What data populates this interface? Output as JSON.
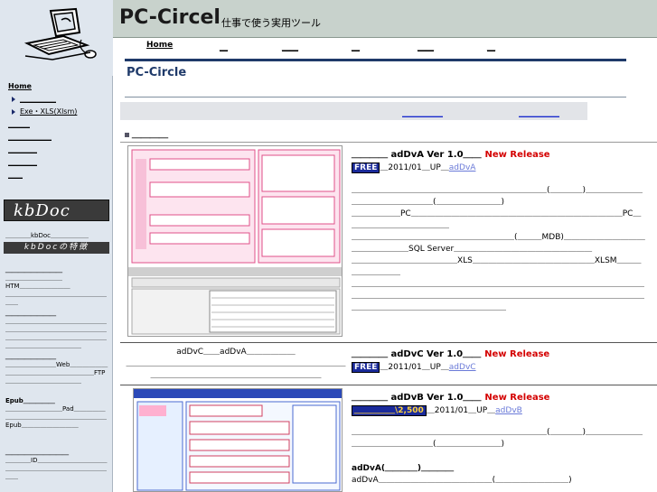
{
  "header": {
    "title": "PC-Circel",
    "subtitle": "仕事で使う実用ツール"
  },
  "topnav": {
    "items": [
      "Home",
      "＿",
      "＿＿",
      "＿",
      "＿＿",
      "＿"
    ]
  },
  "page": {
    "heading": "PC-Circle"
  },
  "subnav": {
    "links": [
      "＿＿＿＿＿",
      "＿＿＿＿＿"
    ]
  },
  "section": {
    "title": "＿＿＿＿"
  },
  "sidebar": {
    "nav": [
      {
        "label": "Home",
        "bold": true,
        "sub": false
      },
      {
        "label": "＿＿＿＿＿",
        "bold": false,
        "sub": true
      },
      {
        "label": "Exe・XLS(Xlsm)",
        "bold": false,
        "sub": true
      },
      {
        "label": "＿＿＿",
        "bold": false,
        "sub": false
      },
      {
        "label": "＿＿＿＿＿＿",
        "bold": false,
        "sub": false
      },
      {
        "label": "＿＿＿＿",
        "bold": false,
        "sub": false
      },
      {
        "label": "＿＿＿＿",
        "bold": false,
        "sub": false
      },
      {
        "label": "＿＿",
        "bold": false,
        "sub": false
      }
    ],
    "kbdoc_logo": "kbDoc",
    "kbdoc_intro": "＿＿＿＿kbDoc＿＿＿＿＿＿",
    "kbdoc_feature": "kbDocの特徴",
    "blocks": [
      {
        "heading": "＿＿＿＿＿＿＿＿＿",
        "lines": [
          "＿＿＿＿＿＿＿＿＿",
          "HTM＿＿＿＿＿＿＿＿",
          "＿＿＿＿＿＿＿＿＿＿＿＿＿＿＿＿＿＿"
        ]
      },
      {
        "heading": "＿＿＿＿＿＿＿＿",
        "lines": [
          "＿＿＿＿＿＿＿＿＿＿＿＿＿＿＿＿＿＿＿＿＿＿＿＿＿＿＿＿＿＿＿＿＿＿＿＿＿＿＿＿＿＿＿＿＿＿＿＿＿＿＿＿＿＿＿＿＿＿＿＿"
        ]
      },
      {
        "heading": "＿＿＿＿＿＿＿＿",
        "lines": [
          "＿＿＿＿＿＿＿＿Web＿＿＿＿＿＿＿＿＿＿＿＿＿＿＿＿＿＿＿＿FTP＿＿＿＿＿＿＿＿＿＿＿＿"
        ]
      },
      {
        "heading": "Epub＿＿＿＿＿",
        "lines": [
          "＿＿＿＿＿＿＿＿＿Pad＿＿＿＿＿＿＿＿＿＿＿＿＿＿＿＿＿＿＿＿＿Epub＿＿＿＿＿＿＿＿＿"
        ]
      },
      {
        "heading": "＿＿＿＿＿＿＿＿＿＿",
        "lines": [
          "＿＿＿＿ID＿＿＿＿＿＿＿＿＿＿＿＿＿＿＿＿＿＿＿＿＿＿＿＿＿＿＿＿＿"
        ]
      }
    ]
  },
  "products": [
    {
      "title": "＿＿＿＿ adDvA Ver 1.0＿＿",
      "badge": "New Release",
      "price": "FREE",
      "date": "＿2011/01＿UP＿",
      "link": "adDvA",
      "desc": [
        "＿＿＿＿＿＿＿＿＿＿＿＿＿＿＿＿＿＿＿＿＿＿＿＿(＿＿＿＿)＿＿＿＿＿＿＿＿＿＿＿＿＿＿＿＿＿(＿＿＿＿＿＿＿＿)",
        "＿＿＿＿＿＿PC＿＿＿＿＿＿＿＿＿＿＿＿＿＿＿＿＿＿＿＿＿＿＿＿＿＿PC＿＿＿＿＿＿＿＿＿＿＿＿＿",
        "＿＿＿＿＿＿＿＿＿＿＿＿＿＿＿＿＿＿＿＿(＿＿＿MDB)＿＿＿＿＿＿＿＿＿＿＿＿＿＿＿＿＿SQL Server＿＿＿＿＿＿＿＿＿＿＿＿＿＿＿＿＿",
        "＿＿＿＿＿＿＿＿＿＿＿＿＿XLS＿＿＿＿＿＿＿＿＿＿＿＿＿＿＿XLSM＿＿＿＿＿＿＿＿＿",
        "＿＿＿＿＿＿＿＿＿＿＿＿＿＿＿＿＿＿＿＿＿＿＿＿＿＿＿＿＿＿＿＿＿＿＿＿＿＿＿＿＿＿＿＿＿＿＿＿＿＿＿＿＿＿＿＿＿＿＿＿＿＿＿＿＿＿＿＿＿＿＿＿＿＿＿＿＿＿＿＿＿＿＿＿＿＿＿＿＿＿＿"
      ]
    },
    {
      "title": "＿＿＿＿ adDvC Ver 1.0＿＿",
      "badge": "New Release",
      "price": "FREE",
      "date": "＿2011/01＿UP＿",
      "link": "adDvC",
      "left_caption": [
        "adDvC＿＿adDvA＿＿＿＿＿＿",
        "＿＿＿＿＿＿＿＿＿＿＿＿＿＿＿＿＿＿＿＿＿＿＿＿＿＿＿＿＿＿＿＿＿＿＿＿＿＿＿＿＿＿＿＿＿＿＿＿"
      ]
    },
    {
      "title": "＿＿＿＿ adDvB Ver 1.0＿＿",
      "badge": "New Release",
      "price": "＿＿＿＿＿\\2,500",
      "date": "＿2011/01＿UP＿",
      "link": "adDvB",
      "desc": [
        "＿＿＿＿＿＿＿＿＿＿＿＿＿＿＿＿＿＿＿＿＿＿＿＿(＿＿＿＿)＿＿＿＿＿＿＿＿＿＿＿＿＿＿＿＿＿(＿＿＿＿＿＿＿＿)"
      ],
      "subheading": "adDvA(＿＿＿＿)＿＿＿＿",
      "subdesc": "adDvA＿＿＿＿＿＿＿＿＿＿＿＿＿＿(＿＿＿＿＿＿＿＿＿)"
    }
  ]
}
